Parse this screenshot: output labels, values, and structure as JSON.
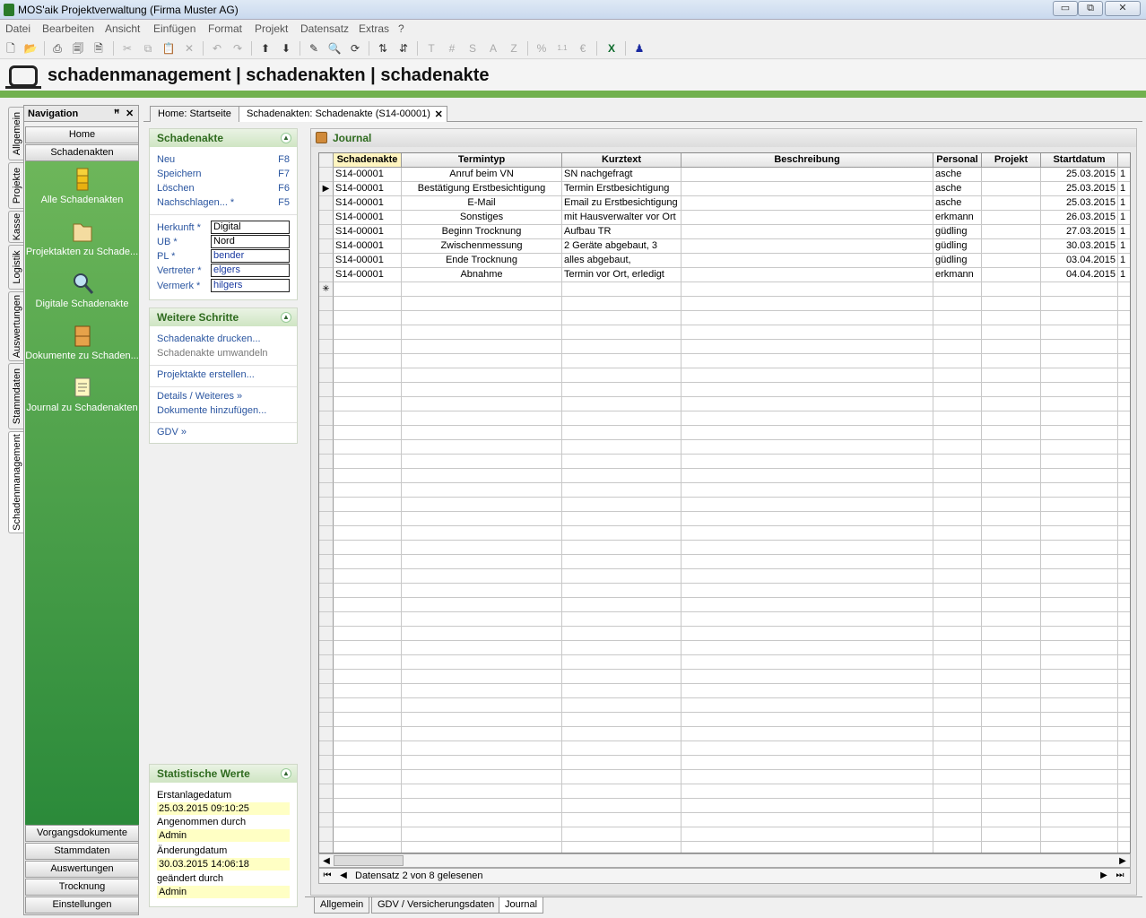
{
  "window": {
    "title": "MOS'aik Projektverwaltung (Firma Muster AG)",
    "min": "▭",
    "max": "⧉",
    "close": "✕"
  },
  "menu": [
    "Datei",
    "Bearbeiten",
    "Ansicht",
    "Einfügen",
    "Format",
    "Projekt",
    "Datensatz",
    "Extras",
    "?"
  ],
  "toolbar": {
    "icons": [
      "new-icon",
      "open-icon",
      "print-icon",
      "print-preview-icon",
      "print-setup-icon",
      "cut-icon",
      "copy-icon",
      "paste-icon",
      "delete-icon",
      "undo-icon",
      "redo-icon",
      "arrow-up-icon",
      "arrow-down-icon",
      "edit-icon",
      "search-icon",
      "refresh-icon",
      "sort-asc-icon",
      "sort-desc-icon",
      "text-t-icon",
      "hash-icon",
      "letter-s-icon",
      "letter-a-icon",
      "letter-z-icon",
      "percent-icon",
      "numbering-icon",
      "currency-icon",
      "excel-icon",
      "user-icon"
    ]
  },
  "header": {
    "title": "schadenmanagement | schadenakten | schadenakte"
  },
  "vtabs": [
    "Allgemein",
    "Projekte",
    "Kasse",
    "Logistik",
    "Auswertungen",
    "Stammdaten",
    "Schadenmanagement"
  ],
  "nav": {
    "title": "Navigation",
    "pin": "ꟸ",
    "close": "✕",
    "top_buttons": [
      "Home",
      "Schadenakten"
    ],
    "items": [
      "Alle Schadenakten",
      "Projektakten zu Schade...",
      "Digitale Schadenakte",
      "Dokumente zu Schaden...",
      "Journal zu Schadenakten"
    ],
    "bottom_buttons": [
      "Vorgangsdokumente",
      "Stammdaten",
      "Auswertungen",
      "Trocknung",
      "Einstellungen"
    ]
  },
  "doc_tabs": [
    "Home: Startseite",
    "Schadenakten: Schadenakte (S14-00001)"
  ],
  "doc_tab_close": "✕",
  "schadenakte": {
    "title": "Schadenakte",
    "chev": "▲",
    "actions": [
      {
        "label": "Neu",
        "key": "F8"
      },
      {
        "label": "Speichern",
        "key": "F7"
      },
      {
        "label": "Löschen",
        "key": "F6"
      },
      {
        "label": "Nachschlagen...  *",
        "key": "F5"
      }
    ],
    "fields": [
      {
        "label": "Herkunft *",
        "value": "Digital"
      },
      {
        "label": "UB *",
        "value": "Nord"
      },
      {
        "label": "PL *",
        "value": "bender"
      },
      {
        "label": "Vertreter *",
        "value": "elgers"
      },
      {
        "label": "Vermerk *",
        "value": "hilgers"
      }
    ]
  },
  "weitere": {
    "title": "Weitere Schritte",
    "chev": "▲",
    "links": [
      "Schadenakte drucken...",
      "Schadenakte umwandeln",
      "Projektakte erstellen...",
      "Details / Weiteres »",
      "Dokumente hinzufügen...",
      "GDV »"
    ]
  },
  "stats": {
    "title": "Statistische Werte",
    "chev": "▲",
    "items": [
      {
        "label": "Erstanlagedatum",
        "value": "25.03.2015 09:10:25"
      },
      {
        "label": "Angenommen durch",
        "value": "Admin"
      },
      {
        "label": "Änderungdatum",
        "value": "30.03.2015 14:06:18"
      },
      {
        "label": "geändert durch",
        "value": "Admin"
      }
    ]
  },
  "journal": {
    "title": "Journal",
    "columns": [
      "Schadenakte",
      "Termintyp",
      "Kurztext",
      "Beschreibung",
      "Personal",
      "Projekt",
      "Startdatum"
    ],
    "rows": [
      [
        "S14-00001",
        "Anruf beim VN",
        "SN nachgefragt",
        "",
        "asche",
        "",
        "25.03.2015",
        "1"
      ],
      [
        "S14-00001",
        "Bestätigung Erstbesichtigung",
        "Termin Erstbesichtigung",
        "",
        "asche",
        "",
        "25.03.2015",
        "1"
      ],
      [
        "S14-00001",
        "E-Mail",
        "Email zu Erstbesichtigung",
        "",
        "asche",
        "",
        "25.03.2015",
        "1"
      ],
      [
        "S14-00001",
        "Sonstiges",
        "mit Hausverwalter vor Ort",
        "",
        "erkmann",
        "",
        "26.03.2015",
        "1"
      ],
      [
        "S14-00001",
        "Beginn Trocknung",
        "Aufbau TR",
        "",
        "güdling",
        "",
        "27.03.2015",
        "1"
      ],
      [
        "S14-00001",
        "Zwischenmessung",
        "2 Geräte abgebaut, 3",
        "",
        "güdling",
        "",
        "30.03.2015",
        "1"
      ],
      [
        "S14-00001",
        "Ende Trocknung",
        "alles abgebaut,",
        "",
        "güdling",
        "",
        "03.04.2015",
        "1"
      ],
      [
        "S14-00001",
        "Abnahme",
        "Termin vor Ort, erledigt",
        "",
        "erkmann",
        "",
        "04.04.2015",
        "1"
      ]
    ],
    "current_row_marker": "▶",
    "new_row_marker": "✳",
    "status": "Datensatz 2 von 8 gelesenen",
    "nav_first": "⏮",
    "nav_prev": "◀",
    "nav_next": "▶",
    "nav_last": "⏭",
    "scroll_left": "◀",
    "scroll_right": "▶"
  },
  "bottom_tabs": [
    "Allgemein",
    "GDV / Versicherungsdaten",
    "Journal"
  ]
}
